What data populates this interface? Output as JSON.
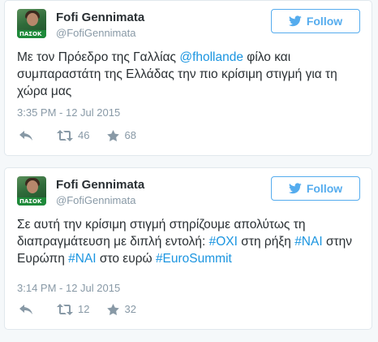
{
  "colors": {
    "accent": "#55acee",
    "link": "#1b95e0",
    "muted": "#8899a6",
    "text": "#292f33"
  },
  "tweets": [
    {
      "author_name": "Fofi Gennimata",
      "handle": "@FofiGennimata",
      "follow_label": "Follow",
      "text_parts": [
        {
          "text": "Με τον Πρόεδρο της Γαλλίας "
        },
        {
          "text": "@fhollande",
          "link": true
        },
        {
          "text": " φίλο και συμπαραστάτη της Ελλάδας την πιο κρίσιμη στιγμή για τη χώρα μας"
        }
      ],
      "timestamp": "3:35 PM - 12 Jul 2015",
      "retweets": "46",
      "favorites": "68",
      "avatar_label": "ΠΑΣΟΚ"
    },
    {
      "author_name": "Fofi Gennimata",
      "handle": "@FofiGennimata",
      "follow_label": "Follow",
      "text_parts": [
        {
          "text": "Σε αυτή την κρίσιμη στιγμή στηρίζουμε απολύτως τη διαπραγμάτευση με διπλή εντολή: "
        },
        {
          "text": "#ΟΧΙ",
          "link": true
        },
        {
          "text": " στη ρήξη "
        },
        {
          "text": "#ΝΑΙ",
          "link": true
        },
        {
          "text": " στην Ευρώπη "
        },
        {
          "text": "#ΝΑΙ",
          "link": true
        },
        {
          "text": " στο ευρώ "
        },
        {
          "text": "#EuroSummit",
          "link": true
        }
      ],
      "timestamp": "3:14 PM - 12 Jul 2015",
      "retweets": "12",
      "favorites": "32",
      "avatar_label": "ΠΑΣΟΚ"
    }
  ],
  "icons": {
    "reply": "reply-icon",
    "retweet": "retweet-icon",
    "favorite": "star-icon",
    "follow": "twitter-bird-icon"
  }
}
